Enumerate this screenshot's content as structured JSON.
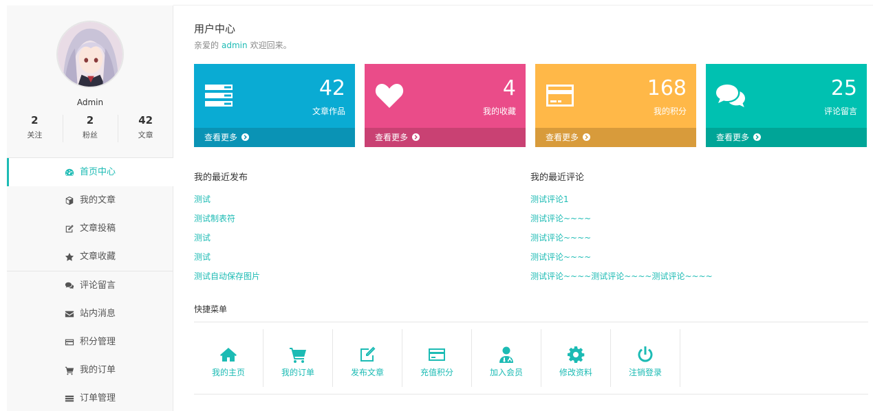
{
  "user": {
    "name": "Admin",
    "stats": [
      {
        "num": "2",
        "label": "关注"
      },
      {
        "num": "2",
        "label": "粉丝"
      },
      {
        "num": "42",
        "label": "文章"
      }
    ]
  },
  "sidebar": {
    "items": [
      {
        "label": "首页中心",
        "icon": "dashboard-icon"
      },
      {
        "label": "我的文章",
        "icon": "cube-icon"
      },
      {
        "label": "文章投稿",
        "icon": "edit-icon"
      },
      {
        "label": "文章收藏",
        "icon": "star-icon"
      },
      {
        "label": "评论留言",
        "icon": "comments-icon"
      },
      {
        "label": "站内消息",
        "icon": "envelope-icon"
      },
      {
        "label": "积分管理",
        "icon": "credit-card-icon"
      },
      {
        "label": "我的订单",
        "icon": "cart-icon"
      },
      {
        "label": "订单管理",
        "icon": "list-icon"
      }
    ]
  },
  "header": {
    "title": "用户中心",
    "welcome_prefix": "亲爱的",
    "welcome_user": "admin",
    "welcome_suffix": "欢迎回来。"
  },
  "cards": [
    {
      "value": "42",
      "label": "文章作品",
      "more": "查看更多",
      "color": "#0aabd3",
      "footer_color": "#0a93b5",
      "icon": "server-icon"
    },
    {
      "value": "4",
      "label": "我的收藏",
      "more": "查看更多",
      "color": "#ea4c89",
      "footer_color": "#c94173",
      "icon": "heart-icon"
    },
    {
      "value": "168",
      "label": "我的积分",
      "more": "查看更多",
      "color": "#ffb848",
      "footer_color": "#d89b3b",
      "icon": "credit-card-icon"
    },
    {
      "value": "25",
      "label": "评论留言",
      "more": "查看更多",
      "color": "#00c1b1",
      "footer_color": "#00a597",
      "icon": "comments-icon"
    }
  ],
  "recent_posts": {
    "title": "我的最近发布",
    "items": [
      "测试",
      "测试制表符",
      "测试",
      "测试",
      "测试自动保存图片"
    ]
  },
  "recent_comments": {
    "title": "我的最近评论",
    "items": [
      "测试评论1",
      "测试评论~~~~",
      "测试评论~~~~",
      "测试评论~~~~",
      "测试评论~~~~测试评论~~~~测试评论~~~~"
    ]
  },
  "quick_menu": {
    "title": "快捷菜单",
    "items": [
      {
        "label": "我的主页",
        "icon": "home-icon"
      },
      {
        "label": "我的订单",
        "icon": "cart-icon"
      },
      {
        "label": "发布文章",
        "icon": "edit-icon"
      },
      {
        "label": "充值积分",
        "icon": "credit-card-icon"
      },
      {
        "label": "加入会员",
        "icon": "user-md-icon"
      },
      {
        "label": "修改资料",
        "icon": "gear-icon"
      },
      {
        "label": "注销登录",
        "icon": "power-icon"
      }
    ]
  },
  "accent_color": "#1cbbb4"
}
